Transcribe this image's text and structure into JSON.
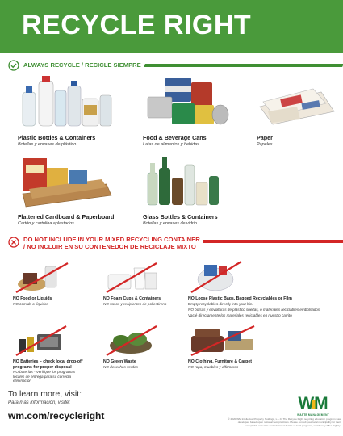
{
  "title": "RECYCLE RIGHT",
  "always_section": {
    "label": "ALWAYS RECYCLE / RECICLE SIEMPRE",
    "items": [
      {
        "label": "Plastic Bottles & Containers",
        "sub": "Botellas y envases de plástico",
        "icon": "plastic-bottles-image"
      },
      {
        "label": "Food & Beverage Cans",
        "sub": "Latas de alimentos y bebidas",
        "icon": "cans-image"
      },
      {
        "label": "Paper",
        "sub": "Papeles",
        "icon": "paper-image"
      },
      {
        "label": "Flattened Cardboard & Paperboard",
        "sub": "Cartón y cartulina aplastados",
        "icon": "cardboard-image"
      },
      {
        "label": "Glass Bottles & Containers",
        "sub": "Botellas y envases de vidrio",
        "icon": "glass-bottles-image"
      }
    ]
  },
  "not_section": {
    "label_line1": "DO NOT INCLUDE IN YOUR MIXED RECYCLING CONTAINER",
    "label_line2": "/ NO INCLUIR EN SU CONTENEDOR DE RECICLAJE MIXTO",
    "items": [
      {
        "label": "NO Food or Liquids",
        "sub": "NO comida o líquidos",
        "icon": "food-liquids-image"
      },
      {
        "label": "NO Foam Cups & Containers",
        "sub": "NO vasos y recipientes de poliestireno",
        "icon": "foam-cups-image"
      },
      {
        "label": "NO Loose Plastic Bags, Bagged Recyclables or Film",
        "desc": "Empty recyclables directly into your bin.",
        "sub": "NO bolsas y envolturas de plástico sueltas, o materiales reciclables embolsados",
        "sub2": "Vacié directamente los materiales reciclables en nuestro carrito",
        "icon": "plastic-bags-image"
      },
      {
        "label": "NO Batteries – check local drop-off programs for proper disposal",
        "sub": "NO baterías - Verifique los programas locales de entrega para su correcta eliminación",
        "icon": "batteries-image"
      },
      {
        "label": "NO Green Waste",
        "sub": "NO desechos verdes",
        "icon": "green-waste-image"
      },
      {
        "label": "NO Clothing, Furniture & Carpet",
        "sub": "NO ropa, muebles y alfombras",
        "icon": "clothing-furniture-image"
      }
    ]
  },
  "footer": {
    "learn": "To learn more, visit:",
    "learn_es": "Para más información, visite:",
    "url": "wm.com/recycleright",
    "logo_text": "WM",
    "logo_tag": "WASTE MANAGEMENT",
    "fine_print": "© 2020 WM Intellectual Property Holdings, L.L.C. The Recycle Right recycling education program was developed based upon national best practices. Please consult your local municipality for their acceptable materials and additional details of local programs, which may differ slightly."
  },
  "colors": {
    "green": "#4a9a3b",
    "red": "#d32626",
    "wm_green": "#1a7a3a",
    "wm_yellow": "#f2b81a"
  }
}
